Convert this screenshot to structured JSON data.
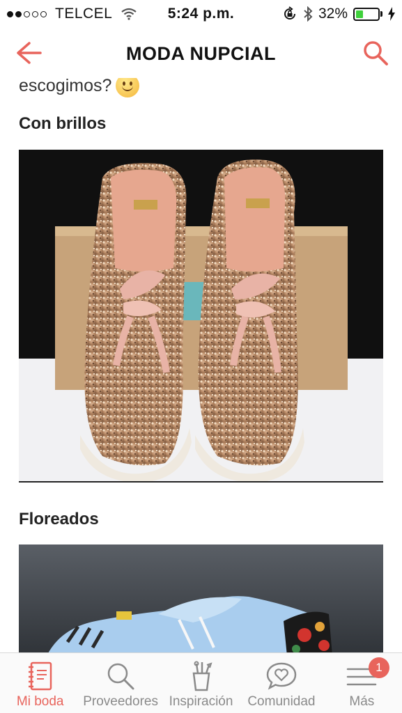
{
  "status_bar": {
    "carrier": "TELCEL",
    "time": "5:24 p.m.",
    "battery_percent": "32%",
    "battery_level": 0.32,
    "signal_bars_filled": 2,
    "icons": [
      "wifi-icon",
      "rotation-lock-icon",
      "bluetooth-icon",
      "charging-icon"
    ]
  },
  "header": {
    "title": "MODA NUPCIAL",
    "back_icon": "back-arrow-icon",
    "search_icon": "search-icon"
  },
  "article": {
    "intro_text": "escogimos?",
    "intro_emoji": "smiley-emoji",
    "sections": [
      {
        "title": "Con brillos",
        "image": "glitter-sneakers-photo"
      },
      {
        "title": "Floreados",
        "image": "floral-sneakers-photo"
      }
    ]
  },
  "tabbar": {
    "tabs": [
      {
        "label": "Mi boda",
        "icon": "notebook-icon",
        "active": true
      },
      {
        "label": "Proveedores",
        "icon": "search-icon"
      },
      {
        "label": "Inspiración",
        "icon": "inspiration-tools-icon"
      },
      {
        "label": "Comunidad",
        "icon": "chat-heart-icon"
      },
      {
        "label": "Más",
        "icon": "menu-icon",
        "badge": "1"
      }
    ]
  },
  "colors": {
    "accent": "#e8645c",
    "battery_fill": "#3fd13b",
    "tab_inactive": "#8a8a8a"
  }
}
